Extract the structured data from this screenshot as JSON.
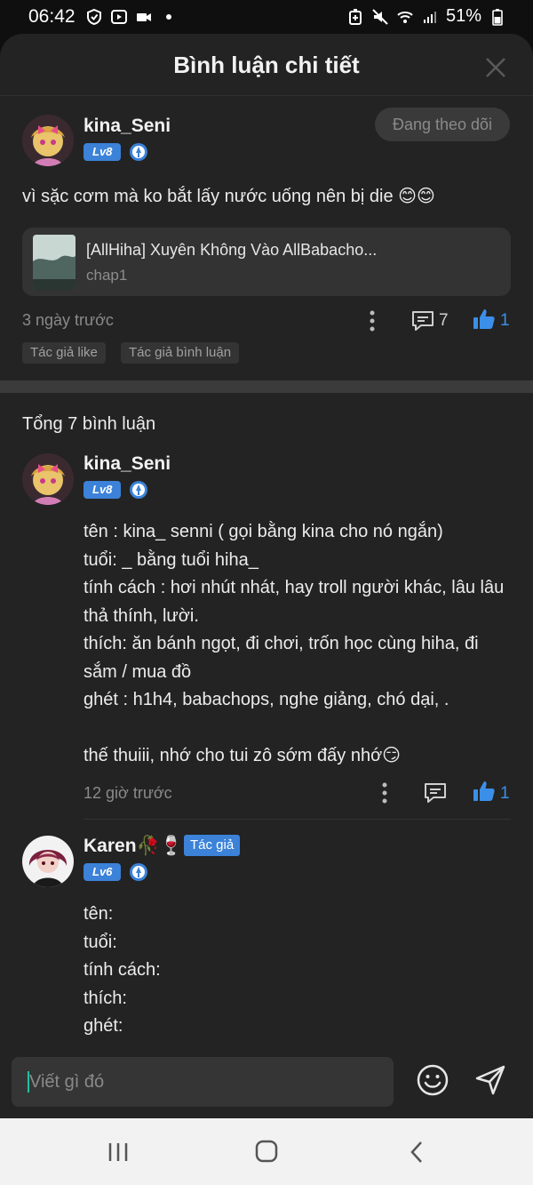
{
  "status_bar": {
    "time": "06:42",
    "battery": "51%"
  },
  "sheet": {
    "title": "Bình luận chi tiết"
  },
  "main_comment": {
    "username": "kina_Seni",
    "level": "Lv8",
    "follow_label": "Đang theo dõi",
    "text": "vì sặc cơm mà ko bắt lấy nước uống nên bị die 😊😊",
    "story": {
      "title": "[AllHiha] Xuyên Không Vào AllBabacho...",
      "chapter": "chap1"
    },
    "time": "3 ngày trước",
    "reply_count": "7",
    "like_count": "1",
    "tags": [
      "Tác giả like",
      "Tác giả bình luận"
    ]
  },
  "total_label": "Tổng 7 bình luận",
  "replies": [
    {
      "username": "kina_Seni",
      "level": "Lv8",
      "body": "tên : kina_ senni ( gọi bằng kina cho nó ngắn)\ntuổi: _ bằng tuổi hiha_\ntính cách : hơi nhút nhát, hay troll người khác, lâu lâu thả thính, lười.\nthích: ăn bánh ngọt, đi chơi, trốn học cùng hiha, đi sắm / mua đồ\nghét : h1h4, babachops, nghe giảng, chó dại, .\n\nthế thuiii, nhớ cho tui zô sớm đấy nhớ😏",
      "time": "12 giờ trước",
      "like_count": "1"
    },
    {
      "username": "Karen🥀🍷",
      "level": "Lv6",
      "author_tag": "Tác giả",
      "body": "tên:\ntuổi:\ntính cách:\nthích:\nghét:"
    }
  ],
  "input": {
    "placeholder": "Viết gì đó"
  },
  "colors": {
    "accent": "#3b82d8",
    "background": "#232323",
    "like": "#3b8fe8"
  }
}
